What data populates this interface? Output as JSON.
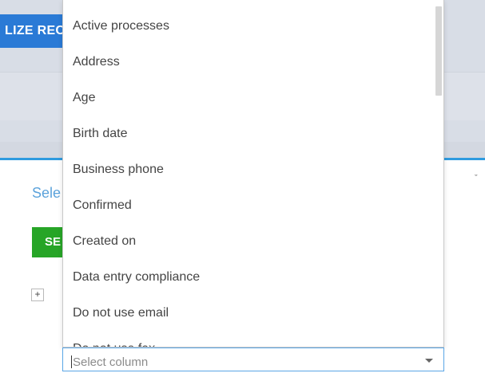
{
  "background": {
    "action_button_label": "LIZE REC",
    "section_label": "Sele",
    "green_button_label": "SE",
    "expand_symbol": "+",
    "chevron_symbol": "ˇ"
  },
  "dropdown": {
    "options": [
      "Active processes",
      "Address",
      "Age",
      "Birth date",
      "Business phone",
      "Confirmed",
      "Created on",
      "Data entry compliance",
      "Do not use email",
      "Do not use fax"
    ]
  },
  "select": {
    "placeholder": "Select column"
  },
  "colors": {
    "accent_blue": "#2a7ad6",
    "green": "#27a527",
    "link_blue": "#5ba2db",
    "focus_border": "#5aa6e6"
  }
}
